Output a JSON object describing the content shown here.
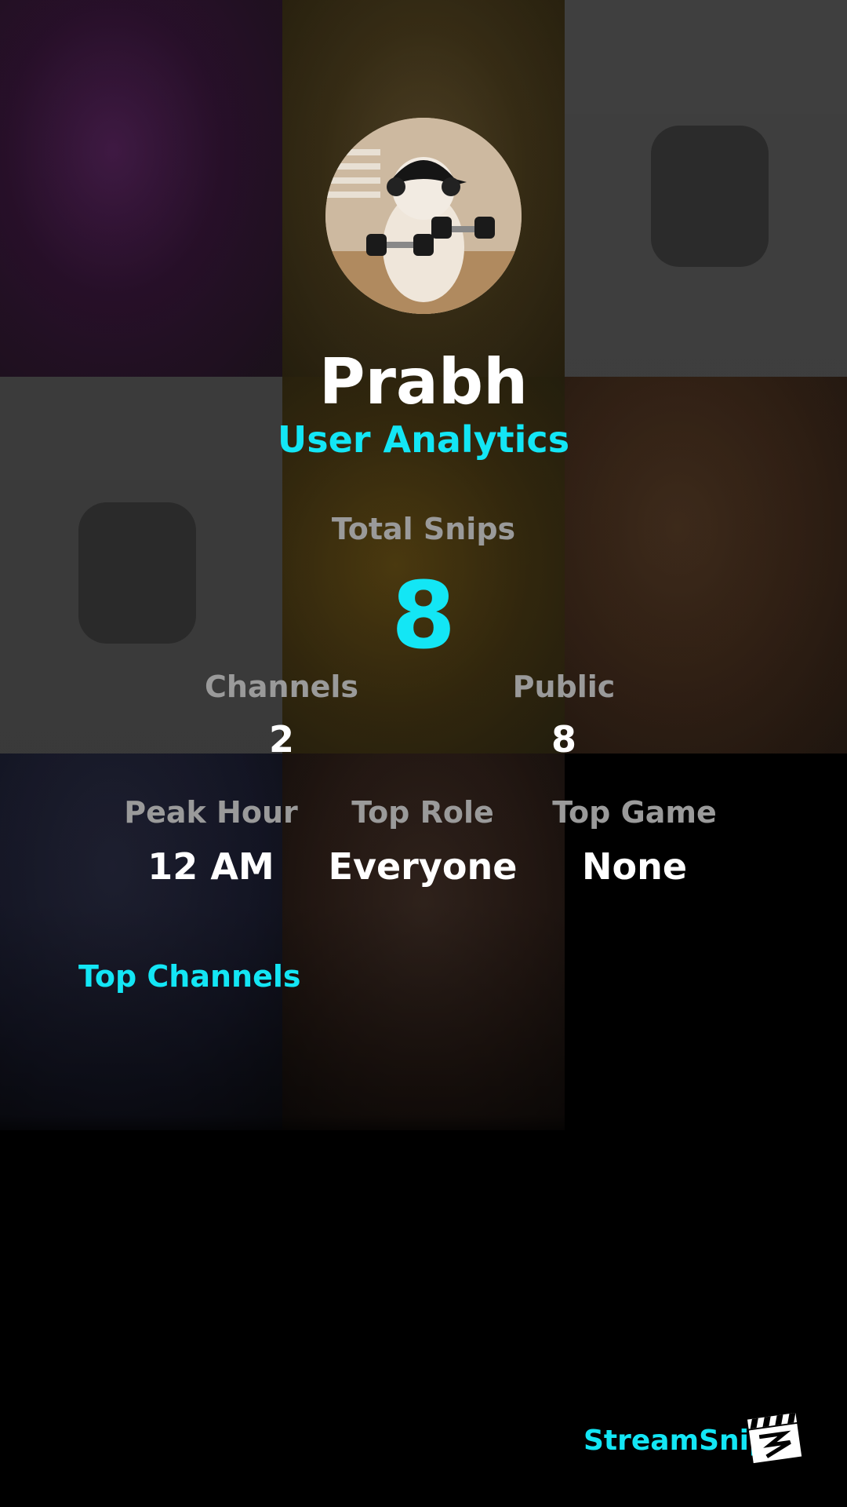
{
  "profile": {
    "name": "Prabh",
    "subtitle": "User Analytics"
  },
  "total": {
    "label": "Total Snips",
    "value": "8"
  },
  "stats_row1": [
    {
      "label": "Channels",
      "value": "2"
    },
    {
      "label": "Public",
      "value": "8"
    }
  ],
  "stats_row2": [
    {
      "label": "Peak Hour",
      "value": "12 AM"
    },
    {
      "label": "Top Role",
      "value": "Everyone"
    },
    {
      "label": "Top Game",
      "value": "None"
    }
  ],
  "sections": {
    "top_channels": "Top Channels"
  },
  "brand": {
    "name": "StreamSnip",
    "icon": "clapperboard-icon"
  },
  "colors": {
    "accent": "#13e6f5",
    "label_gray": "#9a9a9a",
    "background": "#000000"
  }
}
